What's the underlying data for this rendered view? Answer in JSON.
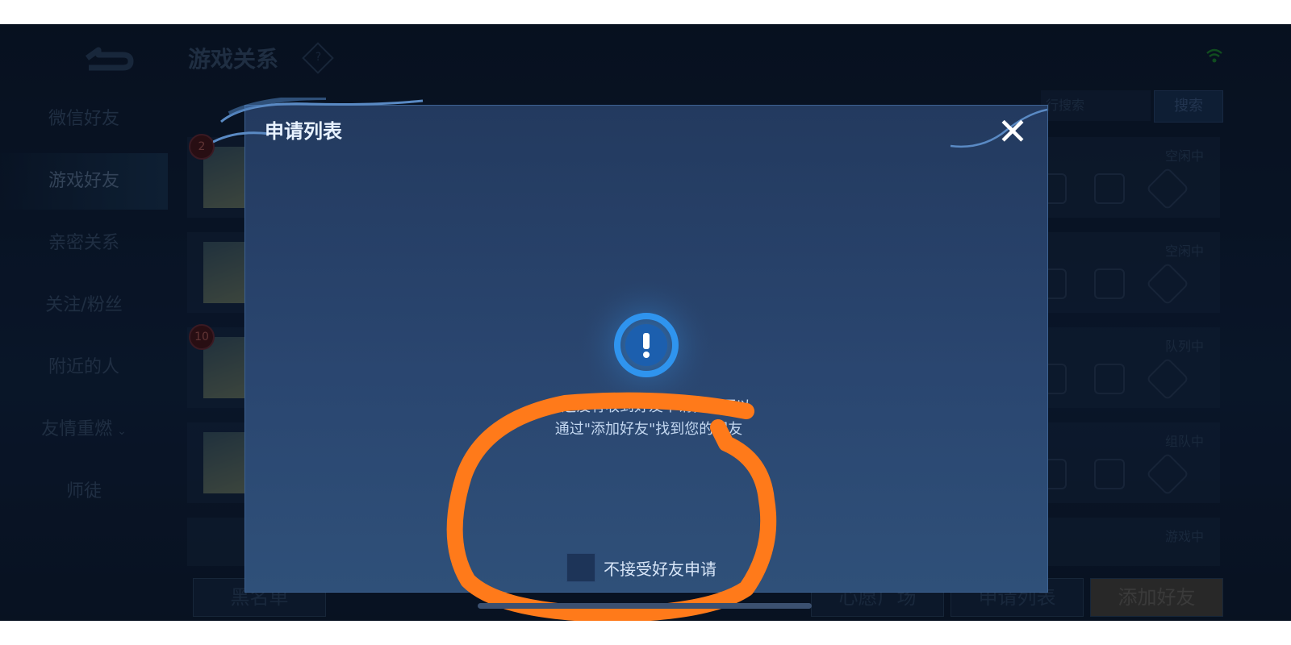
{
  "header": {
    "title": "游戏关系",
    "help": "?"
  },
  "sidebar": {
    "items": [
      {
        "label": "微信好友"
      },
      {
        "label": "游戏好友"
      },
      {
        "label": "亲密关系"
      },
      {
        "label": "关注/粉丝"
      },
      {
        "label": "附近的人"
      },
      {
        "label": "友情重燃"
      },
      {
        "label": "师徒"
      }
    ],
    "selected_index": 1
  },
  "search": {
    "placeholder": "行搜索",
    "button_label": "搜索"
  },
  "friends": [
    {
      "status": "空闲中",
      "badge": "2"
    },
    {
      "status": "空闲中",
      "badge": ""
    },
    {
      "status": "队列中",
      "badge": "10"
    },
    {
      "status": "组队中",
      "badge": ""
    },
    {
      "status": "游戏中",
      "badge": ""
    }
  ],
  "bottom_buttons": {
    "blacklist": "黑名单",
    "wish_square": "心愿广场",
    "apply_list": "申请列表",
    "add_friend": "添加好友"
  },
  "dialog": {
    "title": "申请列表",
    "close": "✕",
    "empty_line1": "您还没有收到好友申请，您可以",
    "empty_line2": "通过\"添加好友\"找到您的朋友",
    "checkbox_label": "不接受好友申请",
    "checkbox_checked": false
  },
  "colors": {
    "annotation": "#ff7a1a",
    "accent": "#1a7fd8"
  }
}
